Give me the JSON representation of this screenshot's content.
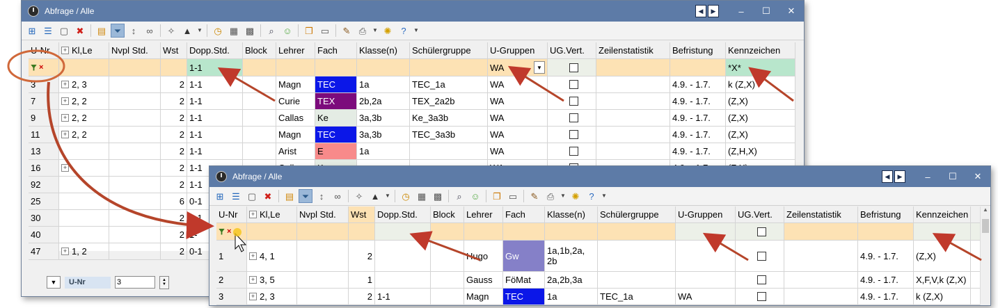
{
  "back": {
    "title": "Abfrage / Alle",
    "columns": [
      "U-Nr",
      "Kl,Le",
      "Nvpl Std.",
      "Wst",
      "Dopp.Std.",
      "Block",
      "Lehrer",
      "Fach",
      "Klasse(n)",
      "Schülergruppe",
      "U-Gruppen",
      "UG.Vert.",
      "Zeilenstatistik",
      "Befristung",
      "Kennzeichen"
    ],
    "filter": {
      "dopp": "1-1",
      "ugruppen": "WA",
      "kennzeichen": "*X*"
    },
    "rows": [
      {
        "unr": "3",
        "klle": "2, 3",
        "wst": "2",
        "dopp": "1-1",
        "lehrer": "Magn",
        "fach": "TEC",
        "klassen": "1a",
        "sg": "TEC_1a",
        "ug": "WA",
        "bef": "4.9. - 1.7.",
        "kz": "k (Z,X)"
      },
      {
        "unr": "7",
        "klle": "2, 2",
        "wst": "2",
        "dopp": "1-1",
        "lehrer": "Curie",
        "fach": "TEX",
        "klassen": "2b,2a",
        "sg": "TEX_2a2b",
        "ug": "WA",
        "bef": "4.9. - 1.7.",
        "kz": " (Z,X)"
      },
      {
        "unr": "9",
        "klle": "2, 2",
        "wst": "2",
        "dopp": "1-1",
        "lehrer": "Callas",
        "fach": "Ke",
        "klassen": "3a,3b",
        "sg": "Ke_3a3b",
        "ug": "WA",
        "bef": "4.9. - 1.7.",
        "kz": " (Z,X)"
      },
      {
        "unr": "11",
        "klle": "2, 2",
        "wst": "2",
        "dopp": "1-1",
        "lehrer": "Magn",
        "fach": "TEC",
        "klassen": "3a,3b",
        "sg": "TEC_3a3b",
        "ug": "WA",
        "bef": "4.9. - 1.7.",
        "kz": " (Z,X)"
      },
      {
        "unr": "13",
        "klle": "",
        "wst": "2",
        "dopp": "1-1",
        "lehrer": "Arist",
        "fach": "E",
        "klassen": "1a",
        "sg": "",
        "ug": "WA",
        "bef": "4.9. - 1.7.",
        "kz": " (Z,H,X)"
      },
      {
        "unr": "16",
        "klle": "",
        "wst": "2",
        "dopp": "1-1",
        "lehrer": "Callas",
        "fach": "Ke",
        "klassen": "",
        "sg": "",
        "ug": "WA",
        "bef": "4.9. - 1.7.",
        "kz": " (Z,X)"
      },
      {
        "unr": "92",
        "klle": "",
        "wst": "2",
        "dopp": "1-1"
      },
      {
        "unr": "25",
        "klle": "",
        "wst": "6",
        "dopp": "0-1"
      },
      {
        "unr": "30",
        "klle": "",
        "wst": "2",
        "dopp": "1-1"
      },
      {
        "unr": "40",
        "klle": "",
        "wst": "2",
        "dopp": "1-"
      },
      {
        "unr": "47",
        "klle": "1, 2",
        "wst": "2",
        "dopp": "0-1"
      }
    ],
    "bottom": {
      "label": "U-Nr",
      "value": "3"
    }
  },
  "front": {
    "title": "Abfrage / Alle",
    "columns": [
      "U-Nr",
      "Kl,Le",
      "Nvpl Std.",
      "Wst",
      "Dopp.Std.",
      "Block",
      "Lehrer",
      "Fach",
      "Klasse(n)",
      "Schülergruppe",
      "U-Gruppen",
      "UG.Vert.",
      "Zeilenstatistik",
      "Befristung",
      "Kennzeichen"
    ],
    "rows": [
      {
        "unr": "1",
        "klle": "4, 1",
        "wst": "2",
        "dopp": "",
        "lehrer": "Hugo",
        "fach": "Gw",
        "klassen": "1a,1b,2a,\n2b",
        "sg": "",
        "ug": "",
        "bef": "4.9. - 1.7.",
        "kz": " (Z,X)"
      },
      {
        "unr": "2",
        "klle": "3, 5",
        "wst": "1",
        "dopp": "",
        "lehrer": "Gauss",
        "fach": "FöMat",
        "klassen": "2a,2b,3a",
        "sg": "",
        "ug": "",
        "bef": "4.9. - 1.7.",
        "kz": "X,F,V,k (Z,X)"
      },
      {
        "unr": "3",
        "klle": "2, 3",
        "wst": "2",
        "dopp": "1-1",
        "lehrer": "Magn",
        "fach": "TEC",
        "klassen": "1a",
        "sg": "TEC_1a",
        "ug": "WA",
        "bef": "4.9. - 1.7.",
        "kz": "k (Z,X)"
      }
    ]
  },
  "toolbar_icons": [
    "new-row-icon",
    "list-icon",
    "new-document-icon",
    "delete-icon",
    "sort-icon",
    "filter-icon",
    "sort-az-icon",
    "link-icon",
    "wand-icon",
    "hat-icon",
    "clock-icon",
    "calculator-icon",
    "grid-icon",
    "find-icon",
    "person-icon",
    "copy-icon",
    "paste-icon",
    "edit-icon",
    "print-icon",
    "settings-icon",
    "help-icon"
  ],
  "colors": {
    "titlebar": "#5d7ba7",
    "accent_orange": "#fde2b4",
    "accent_green": "#b8e6cc",
    "arrow": "#c0392b"
  }
}
